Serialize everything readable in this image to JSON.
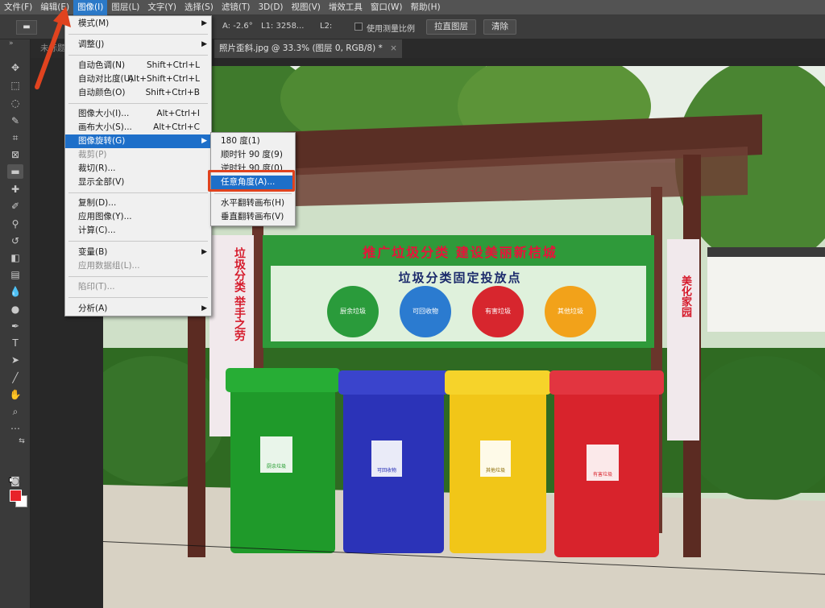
{
  "menubar": {
    "items": [
      "文件(F)",
      "编辑(E)",
      "图像(I)",
      "图层(L)",
      "文字(Y)",
      "选择(S)",
      "滤镜(T)",
      "3D(D)",
      "视图(V)",
      "增效工具",
      "窗口(W)",
      "帮助(H)"
    ],
    "active_index": 2
  },
  "options": {
    "tool_icon": "ruler-icon",
    "angle": "A: -2.6°",
    "length": "L1: 3258...",
    "length2": "L2:",
    "use_scale_label": "使用测量比例",
    "straighten_label": "拉直图层",
    "clear_label": "清除"
  },
  "tabs": {
    "inactive_label": "未标题",
    "active_label": "照片歪斜.jpg @ 33.3% (图层 0, RGB/8) *",
    "close_glyph": "×"
  },
  "image_menu": {
    "items": [
      {
        "label": "模式(M)",
        "shortcut": "",
        "submenu": true
      },
      {
        "label": "调整(J)",
        "shortcut": "",
        "submenu": true
      },
      {
        "label": "自动色调(N)",
        "shortcut": "Shift+Ctrl+L"
      },
      {
        "label": "自动对比度(U)",
        "shortcut": "Alt+Shift+Ctrl+L"
      },
      {
        "label": "自动颜色(O)",
        "shortcut": "Shift+Ctrl+B"
      },
      {
        "label": "图像大小(I)...",
        "shortcut": "Alt+Ctrl+I"
      },
      {
        "label": "画布大小(S)...",
        "shortcut": "Alt+Ctrl+C"
      },
      {
        "label": "图像旋转(G)",
        "shortcut": "",
        "submenu": true,
        "highlighted": true
      },
      {
        "label": "裁剪(P)",
        "shortcut": "",
        "disabled": true
      },
      {
        "label": "裁切(R)...",
        "shortcut": ""
      },
      {
        "label": "显示全部(V)",
        "shortcut": ""
      },
      {
        "label": "复制(D)...",
        "shortcut": ""
      },
      {
        "label": "应用图像(Y)...",
        "shortcut": ""
      },
      {
        "label": "计算(C)...",
        "shortcut": ""
      },
      {
        "label": "变量(B)",
        "shortcut": "",
        "submenu": true
      },
      {
        "label": "应用数据组(L)...",
        "shortcut": "",
        "disabled": true
      },
      {
        "label": "陷印(T)...",
        "shortcut": "",
        "disabled": true
      },
      {
        "label": "分析(A)",
        "shortcut": "",
        "submenu": true
      }
    ]
  },
  "rotate_submenu": {
    "items": [
      "180 度(1)",
      "顺时针 90 度(9)",
      "逆时针 90 度(0)",
      "任意角度(A)...",
      "水平翻转画布(H)",
      "垂直翻转画布(V)"
    ],
    "highlighted_index": 3
  },
  "photo": {
    "banner_title": "推广垃圾分类 建设美丽新桔城",
    "banner_subtitle": "垃圾分类固定投放点",
    "left_panel": "垃圾分类 举手之劳",
    "right_panel": "美化家园",
    "circles": [
      "厨余垃圾",
      "可回收物",
      "有害垃圾",
      "其他垃圾"
    ],
    "bin_labels": [
      "厨余垃圾",
      "可回收物",
      "其他垃圾",
      "有害垃圾"
    ]
  },
  "colors": {
    "accent": "#1e6fc9",
    "callout": "#e0431f",
    "foreground": "#e8232a",
    "background": "#ffffff"
  }
}
